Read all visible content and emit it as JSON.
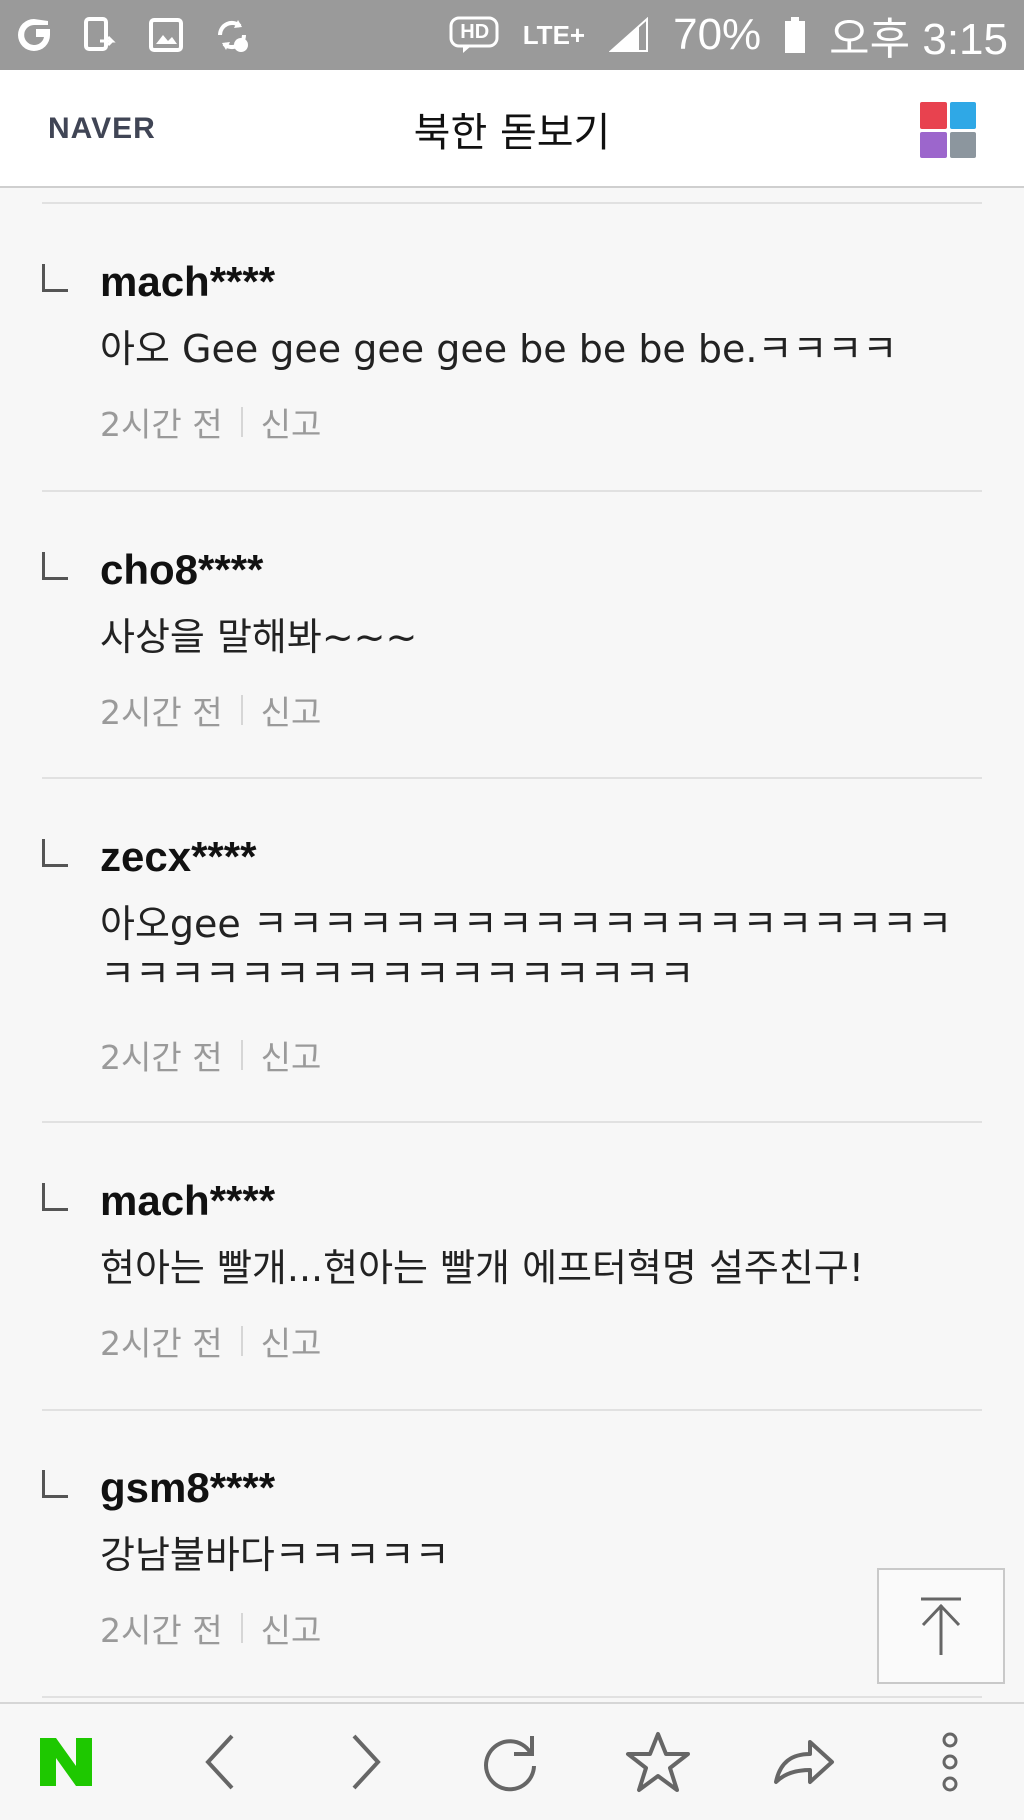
{
  "status_bar": {
    "network": "LTE+",
    "hd_label": "HD",
    "battery": "70%",
    "time": "오후 3:15"
  },
  "header": {
    "logo": "NAVER",
    "title": "북한 돋보기",
    "apps_colors": [
      "#e8424f",
      "#2fa8e6",
      "#9c66cc",
      "#8c969e"
    ]
  },
  "comments": [
    {
      "author": "mach****",
      "text": "아오 Gee gee gee gee be be be be.ㅋㅋㅋㅋ",
      "time": "2시간 전",
      "report": "신고"
    },
    {
      "author": "cho8****",
      "text": "사상을 말해봐~~~",
      "time": "2시간 전",
      "report": "신고"
    },
    {
      "author": "zecx****",
      "text": "아오gee ㅋㅋㅋㅋㅋㅋㅋㅋㅋㅋㅋㅋㅋㅋㅋㅋㅋㅋㅋㅋㅋㅋㅋㅋㅋㅋㅋㅋㅋㅋㅋㅋㅋㅋㅋㅋㅋ",
      "time": "2시간 전",
      "report": "신고"
    },
    {
      "author": "mach****",
      "text": "현아는 빨개...현아는 빨개 에프터혁명 설주친구!",
      "time": "2시간 전",
      "report": "신고"
    },
    {
      "author": "gsm8****",
      "text": "강남불바다ㅋㅋㅋㅋㅋ",
      "time": "2시간 전",
      "report": "신고"
    }
  ],
  "bottom_bar": {
    "home_logo": "N",
    "home_color": "#1ec800",
    "icons": [
      "back-icon",
      "forward-icon",
      "refresh-icon",
      "star-icon",
      "share-icon",
      "more-icon"
    ]
  },
  "scroll_top": {
    "icon": "arrow-up-to-top-icon"
  }
}
